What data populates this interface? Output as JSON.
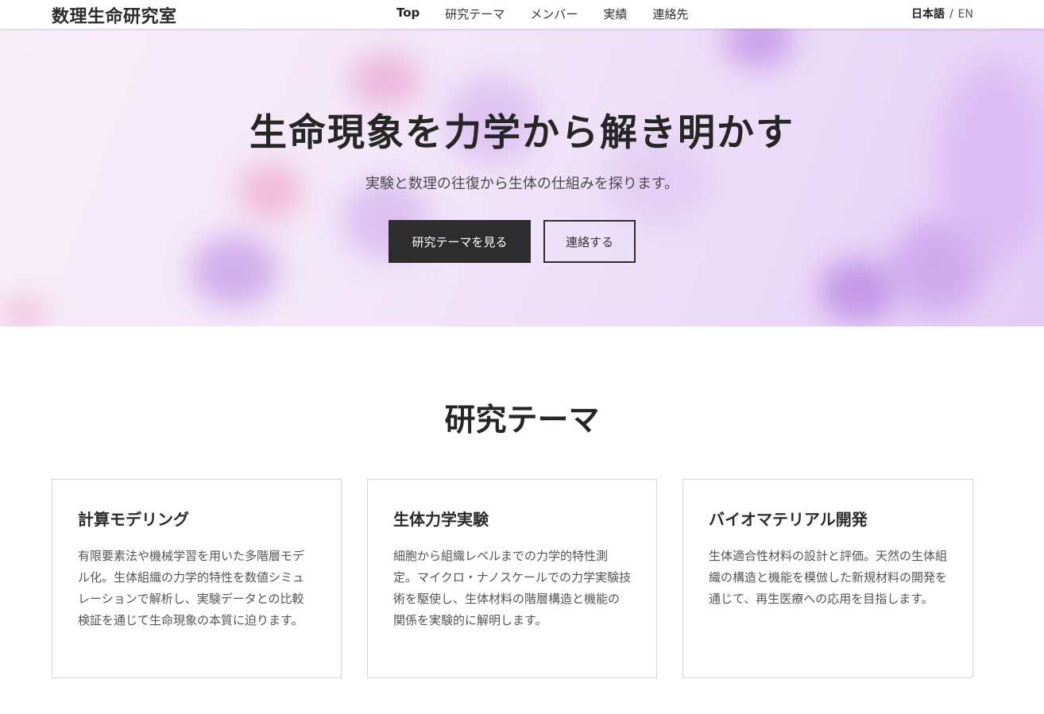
{
  "header": {
    "logo": "数理生命研究室",
    "nav": [
      "Top",
      "研究テーマ",
      "メンバー",
      "実績",
      "連絡先"
    ],
    "lang": {
      "ja": "日本語",
      "separator": "/",
      "en": "EN"
    }
  },
  "hero": {
    "title": "生命現象を力学から解き明かす",
    "subtitle": "実験と数理の往復から生体の仕組みを探ります。",
    "primary_button": "研究テーマを見る",
    "secondary_button": "連絡する"
  },
  "research": {
    "title": "研究テーマ",
    "cards": [
      {
        "title": "計算モデリング",
        "description": "有限要素法や機械学習を用いた多階層モデル化。生体組織の力学的特性を数値シミュレーションで解析し、実験データとの比較検証を通じて生命現象の本質に迫ります。"
      },
      {
        "title": "生体力学実験",
        "description": "細胞から組織レベルまでの力学的特性測定。マイクロ・ナノスケールでの力学実験技術を駆使し、生体材料の階層構造と機能の関係を実験的に解明します。"
      },
      {
        "title": "バイオマテリアル開発",
        "description": "生体適合性材料の設計と評価。天然の生体組織の構造と機能を模倣した新規材料の開発を通じて、再生医療への応用を目指します。"
      }
    ]
  },
  "colors": {
    "primary_button_bg": "#2d2d2d",
    "hero_tint": "#e8d6f8",
    "text": "#2b2b2b"
  }
}
